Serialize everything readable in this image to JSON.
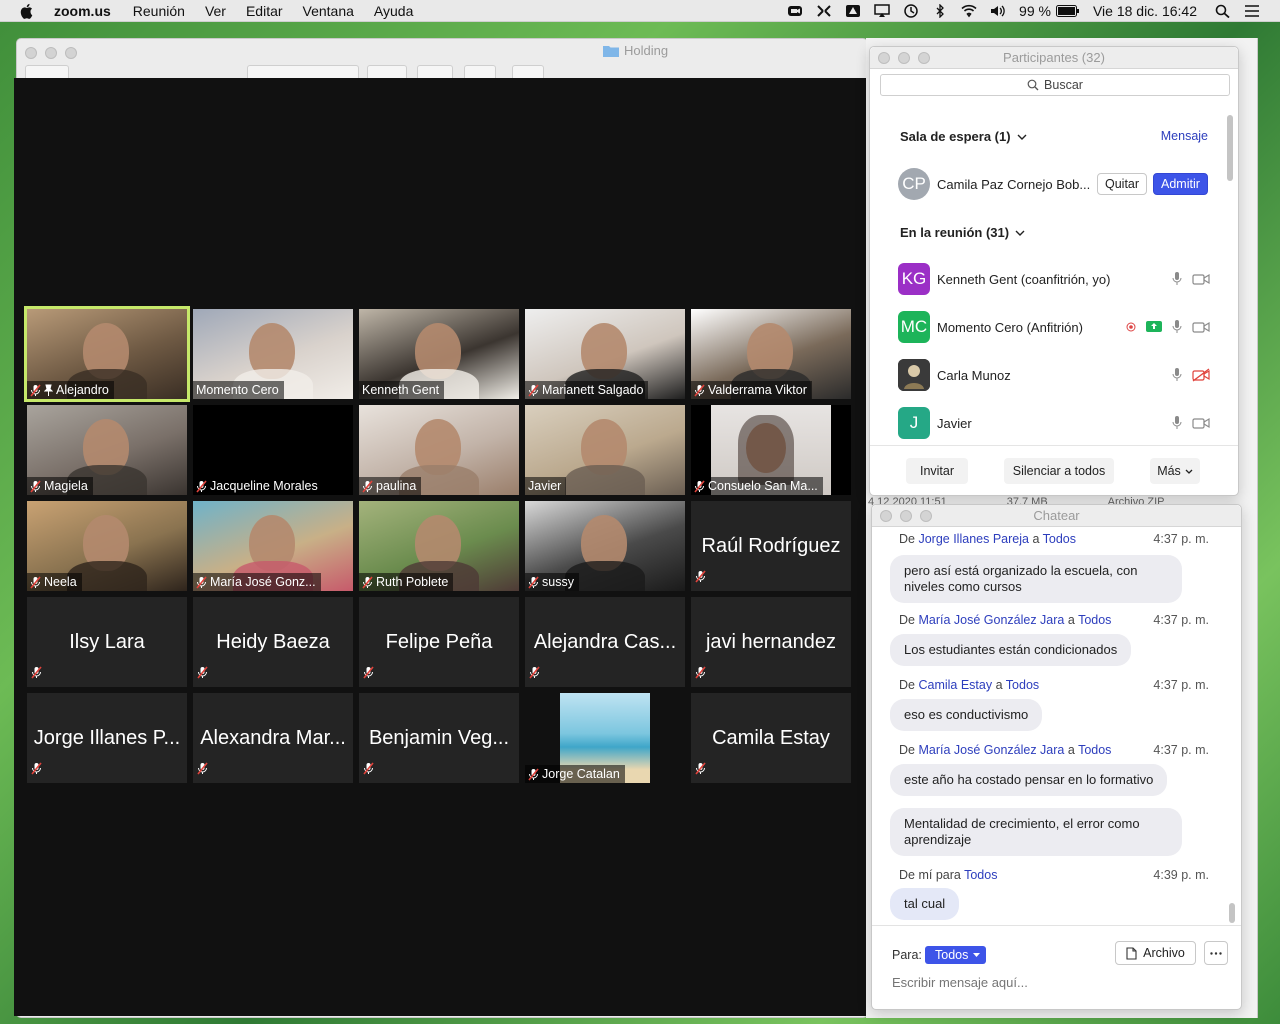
{
  "menubar": {
    "app_name": "zoom.us",
    "items": [
      "Reunión",
      "Ver",
      "Editar",
      "Ventana",
      "Ayuda"
    ],
    "battery": "99 %",
    "datetime": "Vie 18 dic. 16:42"
  },
  "finder": {
    "title": "Holding",
    "bg_row_date": "4 12 2020 11:51",
    "bg_row_size": "37,7 MB",
    "bg_row_kind": "Archivo ZIP"
  },
  "video_grid": {
    "tiles": [
      {
        "name": "Alejandro",
        "kind": "photo",
        "muted": true,
        "pinned": true,
        "active": true
      },
      {
        "name": "Momento Cero",
        "kind": "photo",
        "muted": false
      },
      {
        "name": "Kenneth Gent",
        "kind": "photo",
        "muted": false
      },
      {
        "name": "Marianett Salgado",
        "kind": "photo",
        "muted": true
      },
      {
        "name": "Valderrama Viktor",
        "kind": "photo",
        "muted": true
      },
      {
        "name": "Magiela",
        "kind": "photo",
        "muted": true
      },
      {
        "name": "Jacqueline Morales",
        "kind": "black",
        "muted": true
      },
      {
        "name": "paulina",
        "kind": "photo",
        "muted": true
      },
      {
        "name": "Javier",
        "kind": "photo",
        "muted": false
      },
      {
        "name": "Consuelo San Ma...",
        "kind": "photo",
        "muted": true
      },
      {
        "name": "Neela",
        "kind": "photo",
        "muted": true
      },
      {
        "name": "María José Gonz...",
        "kind": "photo",
        "muted": true
      },
      {
        "name": "Ruth Poblete",
        "kind": "photo",
        "muted": true
      },
      {
        "name": "sussy",
        "kind": "photo",
        "muted": true
      },
      {
        "name": "Raúl Rodríguez",
        "kind": "name",
        "muted": true
      },
      {
        "name": "Ilsy Lara",
        "kind": "name",
        "muted": true
      },
      {
        "name": "Heidy Baeza",
        "kind": "name",
        "muted": true
      },
      {
        "name": "Felipe Peña",
        "kind": "name",
        "muted": true
      },
      {
        "name": "Alejandra Cas...",
        "kind": "name",
        "muted": true
      },
      {
        "name": "javi hernandez",
        "kind": "name",
        "muted": true
      },
      {
        "name": "Jorge Illanes P...",
        "kind": "name",
        "muted": true
      },
      {
        "name": "Alexandra Mar...",
        "kind": "name",
        "muted": true
      },
      {
        "name": "Benjamin Veg...",
        "kind": "name",
        "muted": true
      },
      {
        "name": "Jorge Catalan",
        "kind": "photo",
        "muted": true
      },
      {
        "name": "Camila Estay",
        "kind": "name",
        "muted": true
      }
    ]
  },
  "participants": {
    "title": "Participantes (32)",
    "search_placeholder": "Buscar",
    "waiting_room": {
      "label": "Sala de espera (1)",
      "message_link": "Mensaje",
      "person": {
        "initials": "CP",
        "name": "Camila Paz Cornejo Bob...",
        "color": "#a2a8b0"
      },
      "remove_label": "Quitar",
      "admit_label": "Admitir"
    },
    "in_meeting_label": "En la reunión (31)",
    "people": [
      {
        "initials": "KG",
        "name": "Kenneth Gent (coanfitrión, yo)",
        "color": "#9b2fc6"
      },
      {
        "initials": "MC",
        "name": "Momento Cero (Anfitrión)",
        "color": "#1db45a"
      },
      {
        "initials": "",
        "name": "Carla Munoz",
        "color": "#2b2b2b"
      },
      {
        "initials": "J",
        "name": "Javier",
        "color": "#25a886"
      }
    ],
    "footer": {
      "invite": "Invitar",
      "mute_all": "Silenciar a todos",
      "more": "Más"
    }
  },
  "chat": {
    "title": "Chatear",
    "messages": [
      {
        "from_prefix": "De",
        "from": "Jorge Illanes Pareja",
        "to_prefix": "a",
        "to": "Todos",
        "time": "4:37 p. m.",
        "text": "pero así está organizado la escuela, con niveles como cursos"
      },
      {
        "from_prefix": "De",
        "from": "María José González Jara",
        "to_prefix": "a",
        "to": "Todos",
        "time": "4:37 p. m.",
        "text": "Los estudiantes están condicionados"
      },
      {
        "from_prefix": "De",
        "from": "Camila Estay",
        "to_prefix": "a",
        "to": "Todos",
        "time": "4:37 p. m.",
        "text": "eso es conductivismo"
      },
      {
        "from_prefix": "De",
        "from": "María José González Jara",
        "to_prefix": "a",
        "to": "Todos",
        "time": "4:37 p. m.",
        "text": "este año ha costado pensar en lo formativo",
        "text2": "Mentalidad de crecimiento, el error como aprendizaje"
      },
      {
        "from_prefix": "De mí",
        "from": "",
        "to_prefix": "para",
        "to": "Todos",
        "time": "4:39 p. m.",
        "text": "tal cual"
      }
    ],
    "to_label": "Para:",
    "to_value": "Todos",
    "file_label": "Archivo",
    "input_placeholder": "Escribir mensaje aquí..."
  }
}
